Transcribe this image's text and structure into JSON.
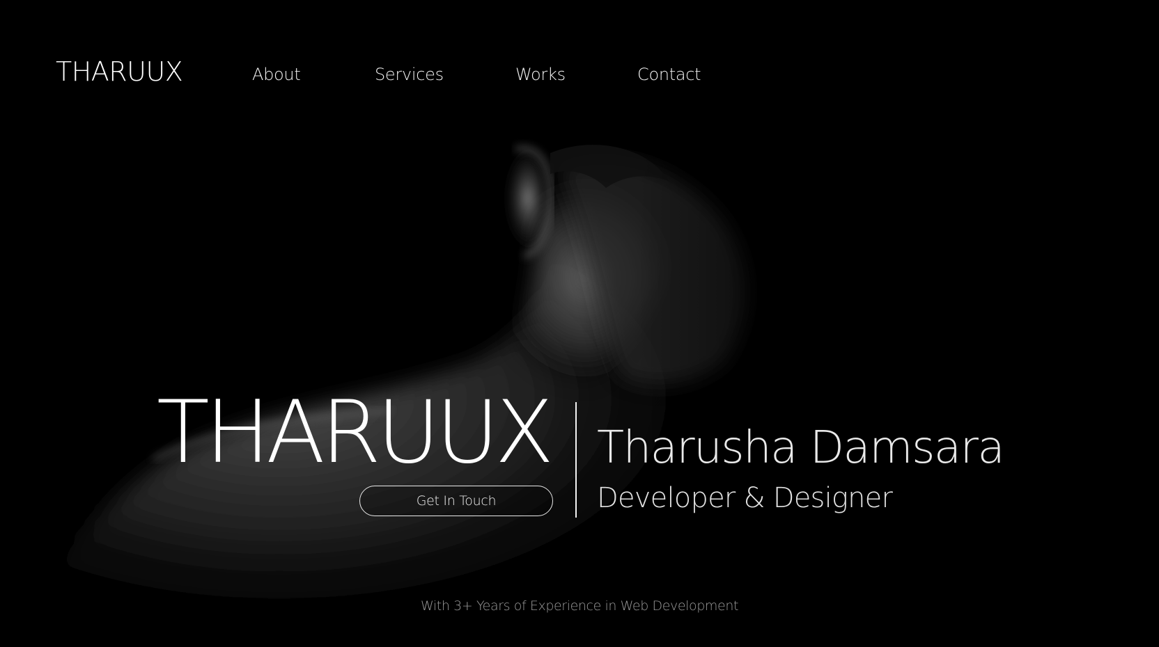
{
  "header": {
    "brand": "THARUUX",
    "nav": [
      {
        "label": "About"
      },
      {
        "label": "Services"
      },
      {
        "label": "Works"
      },
      {
        "label": "Contact"
      }
    ]
  },
  "hero": {
    "title": "THARUUX",
    "cta_label": "Get In Touch",
    "name": "Tharusha Damsara",
    "role": "Developer & Designer",
    "experience": "With 3+ Years of Experience in Web Development"
  },
  "colors": {
    "background": "#000000",
    "text": "#ffffff",
    "muted": "#9a9a9a"
  }
}
